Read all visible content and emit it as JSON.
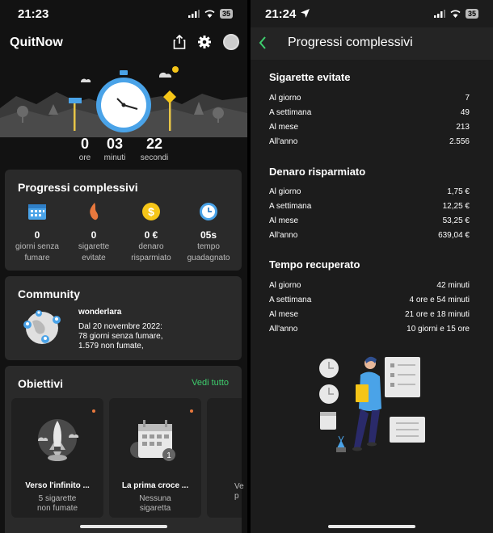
{
  "left": {
    "status": {
      "time": "21:23",
      "battery": "35"
    },
    "app_title": "QuitNow",
    "timer": [
      {
        "value": "0",
        "label": "ore"
      },
      {
        "value": "03",
        "label": "minuti"
      },
      {
        "value": "22",
        "label": "secondi"
      }
    ],
    "progress_card": {
      "title": "Progressi complessivi",
      "stats": [
        {
          "icon": "calendar-icon",
          "value": "0",
          "label1": "giorni senza",
          "label2": "fumare"
        },
        {
          "icon": "flame-icon",
          "value": "0",
          "label1": "sigarette",
          "label2": "evitate"
        },
        {
          "icon": "coin-icon",
          "value": "0 €",
          "label1": "denaro",
          "label2": "risparmiato"
        },
        {
          "icon": "clock-icon",
          "value": "05s",
          "label1": "tempo",
          "label2": "guadagnato"
        }
      ]
    },
    "community": {
      "title": "Community",
      "user": "wonderlara",
      "line1": "Dal 20 novembre 2022:",
      "line2": "78 giorni senza fumare,",
      "line3": "1.579 non fumate,"
    },
    "goals": {
      "title": "Obiettivi",
      "see_all": "Vedi tutto",
      "items": [
        {
          "title": "Verso l'infinito ...",
          "sub1": "5 sigarette",
          "sub2": "non fumate"
        },
        {
          "title": "La prima croce ...",
          "sub1": "Nessuna",
          "sub2": "sigaretta"
        },
        {
          "title": "",
          "sub1": "Ve",
          "sub2": "p"
        }
      ]
    }
  },
  "right": {
    "status": {
      "time": "21:24",
      "battery": "35"
    },
    "title": "Progressi complessivi",
    "sections": [
      {
        "title": "Sigarette evitate",
        "rows": [
          {
            "k": "Al giorno",
            "v": "7"
          },
          {
            "k": "A settimana",
            "v": "49"
          },
          {
            "k": "Al mese",
            "v": "213"
          },
          {
            "k": "All'anno",
            "v": "2.556"
          }
        ]
      },
      {
        "title": "Denaro risparmiato",
        "rows": [
          {
            "k": "Al giorno",
            "v": "1,75 €"
          },
          {
            "k": "A settimana",
            "v": "12,25 €"
          },
          {
            "k": "Al mese",
            "v": "53,25 €"
          },
          {
            "k": "All'anno",
            "v": "639,04 €"
          }
        ]
      },
      {
        "title": "Tempo recuperato",
        "rows": [
          {
            "k": "Al giorno",
            "v": "42 minuti"
          },
          {
            "k": "A settimana",
            "v": "4 ore e 54 minuti"
          },
          {
            "k": "Al mese",
            "v": "21 ore e 18 minuti"
          },
          {
            "k": "All'anno",
            "v": "10 giorni e 15 ore"
          }
        ]
      }
    ]
  },
  "colors": {
    "accent_green": "#3ecf6e",
    "card": "#2a2a2a",
    "stopwatch_blue": "#4aa3e8",
    "coin_yellow": "#f5c518",
    "flame_orange": "#e8783d"
  }
}
